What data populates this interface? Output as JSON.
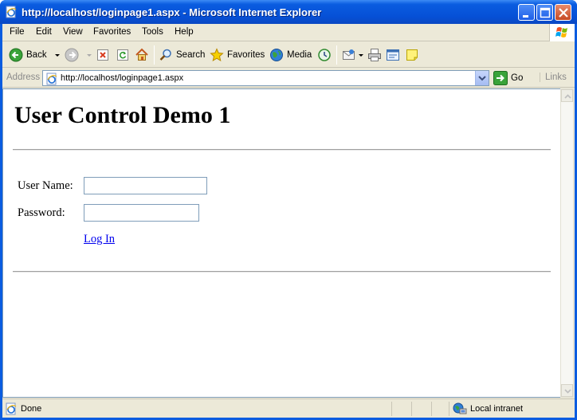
{
  "window": {
    "title": "http://localhost/loginpage1.aspx - Microsoft Internet Explorer"
  },
  "menu": [
    {
      "label": "File"
    },
    {
      "label": "Edit"
    },
    {
      "label": "View"
    },
    {
      "label": "Favorites"
    },
    {
      "label": "Tools"
    },
    {
      "label": "Help"
    }
  ],
  "toolbar": {
    "back_label": "Back",
    "search_label": "Search",
    "favorites_label": "Favorites",
    "media_label": "Media"
  },
  "address": {
    "label": "Address",
    "url": "http://localhost/loginpage1.aspx",
    "go_label": "Go",
    "links_label": "Links"
  },
  "page": {
    "heading": "User Control Demo 1",
    "username_label": "User Name:",
    "username_value": "",
    "password_label": "Password:",
    "password_value": "",
    "login_link": "Log In"
  },
  "status": {
    "text": "Done",
    "zone": "Local intranet"
  },
  "colors": {
    "titlebar": "#0a5ce0",
    "chrome": "#ece9d8",
    "link": "#0000ee"
  }
}
